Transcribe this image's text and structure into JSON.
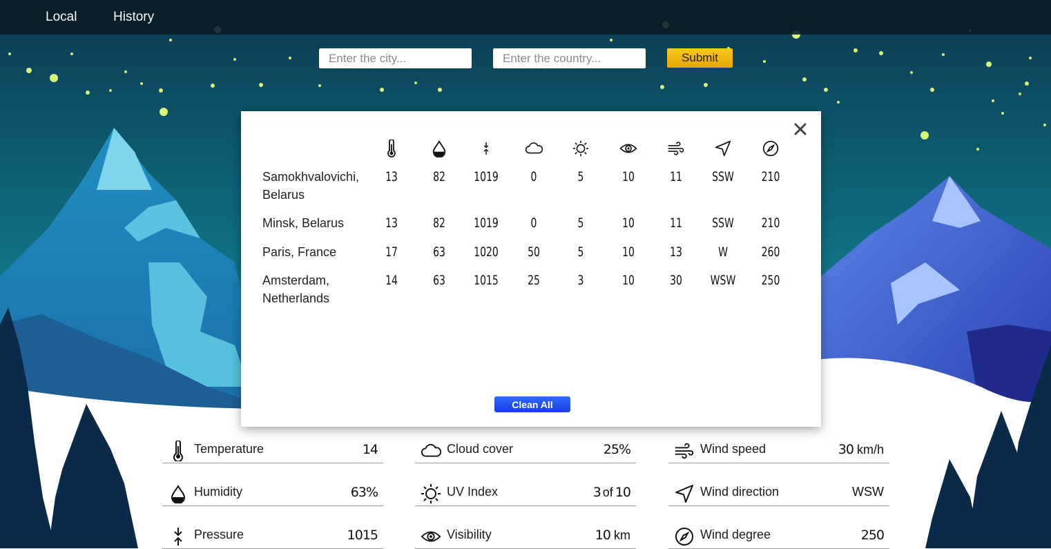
{
  "nav": {
    "local": "Local",
    "history": "History"
  },
  "search": {
    "city_placeholder": "Enter the city...",
    "country_placeholder": "Enter the country...",
    "submit_label": "Submit"
  },
  "history_modal": {
    "columns": [
      {
        "icon": "thermometer-icon"
      },
      {
        "icon": "humidity-drop-icon"
      },
      {
        "icon": "pressure-icon"
      },
      {
        "icon": "cloud-icon"
      },
      {
        "icon": "sun-uv-icon"
      },
      {
        "icon": "eye-visibility-icon"
      },
      {
        "icon": "wind-icon"
      },
      {
        "icon": "navigation-arrow-icon"
      },
      {
        "icon": "compass-icon"
      }
    ],
    "rows": [
      {
        "city": "Samokhvalovichi, Belarus",
        "values": [
          "13",
          "82",
          "1019",
          "0",
          "5",
          "10",
          "11",
          "SSW",
          "210"
        ]
      },
      {
        "city": "Minsk, Belarus",
        "values": [
          "13",
          "82",
          "1019",
          "0",
          "5",
          "10",
          "11",
          "SSW",
          "210"
        ]
      },
      {
        "city": "Paris, France",
        "values": [
          "17",
          "63",
          "1020",
          "50",
          "5",
          "10",
          "13",
          "W",
          "260"
        ]
      },
      {
        "city": "Amsterdam, Netherlands",
        "values": [
          "14",
          "63",
          "1015",
          "25",
          "3",
          "10",
          "30",
          "WSW",
          "250"
        ]
      }
    ],
    "clean_all_label": "Clean All"
  },
  "current": {
    "temperature": {
      "label": "Temperature",
      "value": "14"
    },
    "humidity": {
      "label": "Humidity",
      "value": "63%"
    },
    "pressure": {
      "label": "Pressure",
      "value": "1015"
    },
    "cloud_cover": {
      "label": "Cloud cover",
      "value": "25%"
    },
    "uv_index": {
      "label": "UV Index",
      "value": "3",
      "of": "of",
      "max": "10"
    },
    "visibility": {
      "label": "Visibility",
      "value": "10",
      "unit": "km"
    },
    "wind_speed": {
      "label": "Wind speed",
      "value": "30",
      "unit": "km/h"
    },
    "wind_direction": {
      "label": "Wind direction",
      "value": "WSW"
    },
    "wind_degree": {
      "label": "Wind degree",
      "value": "250"
    }
  },
  "colors": {
    "sky_top": "#0b3a52",
    "sky_bottom": "#1a9aa0",
    "submit_button": "#f2bd12",
    "clean_button": "#2450f0",
    "snow": "#ffffff",
    "tree": "#0b2a4a"
  }
}
